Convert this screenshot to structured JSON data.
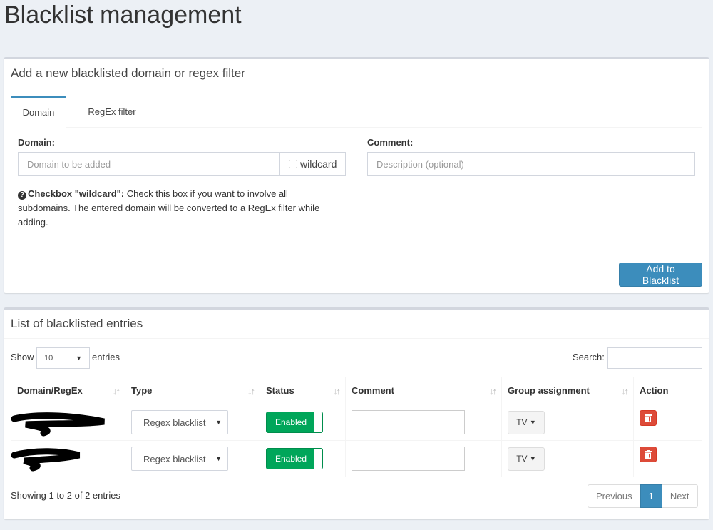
{
  "page": {
    "title": "Blacklist management"
  },
  "add_box": {
    "title": "Add a new blacklisted domain or regex filter",
    "tabs": [
      {
        "label": "Domain",
        "active": true
      },
      {
        "label": "RegEx filter",
        "active": false
      }
    ],
    "domain_label": "Domain:",
    "domain_placeholder": "Domain to be added",
    "wildcard_label": "wildcard",
    "comment_label": "Comment:",
    "comment_placeholder": "Description (optional)",
    "help_bold": "Checkbox \"wildcard\":",
    "help_line1": " Check this box if you want to involve all",
    "help_line2": "subdomains. The entered domain will be converted to a RegEx filter while",
    "help_line3": "adding.",
    "add_button": "Add to Blacklist"
  },
  "list_box": {
    "title": "List of blacklisted entries",
    "show_label": "Show",
    "page_size": "10",
    "entries_label": "entries",
    "search_label": "Search:",
    "columns": [
      "Domain/RegEx",
      "Type",
      "Status",
      "Comment",
      "Group assignment",
      "Action"
    ],
    "rows": [
      {
        "type": "Regex blacklist",
        "status": "Enabled",
        "group": "TV"
      },
      {
        "type": "Regex blacklist",
        "status": "Enabled",
        "group": "TV"
      }
    ],
    "info": "Showing 1 to 2 of 2 entries",
    "pagination": {
      "previous": "Previous",
      "current": "1",
      "next": "Next"
    }
  },
  "colors": {
    "primary": "#3c8dbc",
    "success": "#00a65a",
    "danger": "#dd4b39"
  }
}
